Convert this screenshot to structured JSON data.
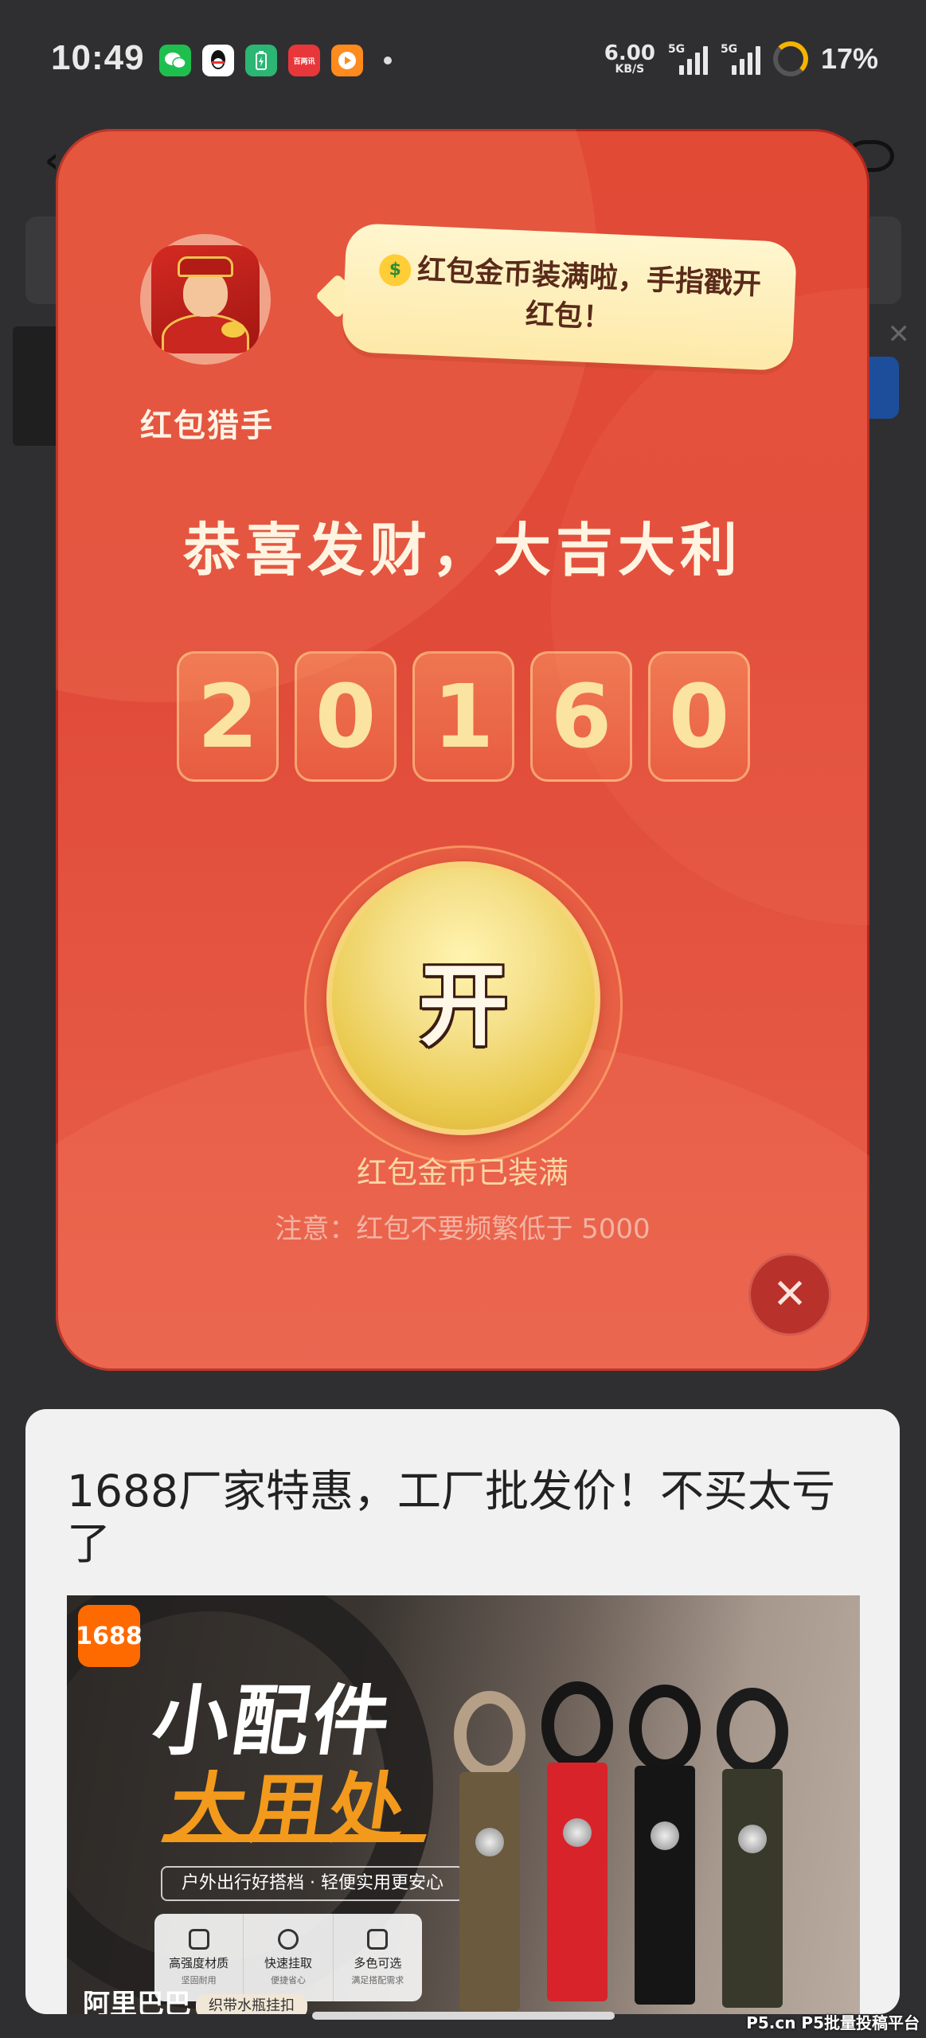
{
  "status_bar": {
    "time": "10:49",
    "app_icons": [
      "wechat-icon",
      "qq-icon",
      "battery-app-icon",
      "news-app-icon",
      "video-app-icon"
    ],
    "news_icon_text": "百两讯",
    "net_speed_value": "6.00",
    "net_speed_unit": "KB/S",
    "signal1_label": "5G",
    "signal2_label": "5G",
    "battery_percent": "17%"
  },
  "popup": {
    "app_name": "红包猎手",
    "bubble_text": "红包金币装满啦，手指戳开红包！",
    "headline": "恭喜发财，大吉大利",
    "digits": [
      "2",
      "0",
      "1",
      "6",
      "0"
    ],
    "open_button_label": "开",
    "filled_label": "红包金币已装满",
    "notice": "注意：红包不要频繁低于 5000",
    "close_label": "✕"
  },
  "ad": {
    "title": "1688厂家特惠，工厂批发价！不买太亏了",
    "logo_text": "1688",
    "promo_line1": "小配件",
    "promo_line2": "大用处",
    "promo_tag": "户外出行好搭档 · 轻便实用更安心",
    "features": [
      {
        "title": "高强度材质",
        "sub": "坚固耐用"
      },
      {
        "title": "快速挂取",
        "sub": "便捷省心"
      },
      {
        "title": "多色可选",
        "sub": "满足搭配需求"
      }
    ],
    "bottom_brand": "阿里巴巴",
    "bottom_chip": "织带水瓶挂扣"
  },
  "watermark": "P5.cn P5批量投稿平台",
  "colors": {
    "popup_red": "#e14a35",
    "gold": "#f5e08a",
    "digit_text": "#fbe3a1",
    "ad_orange": "#ff6a00"
  }
}
